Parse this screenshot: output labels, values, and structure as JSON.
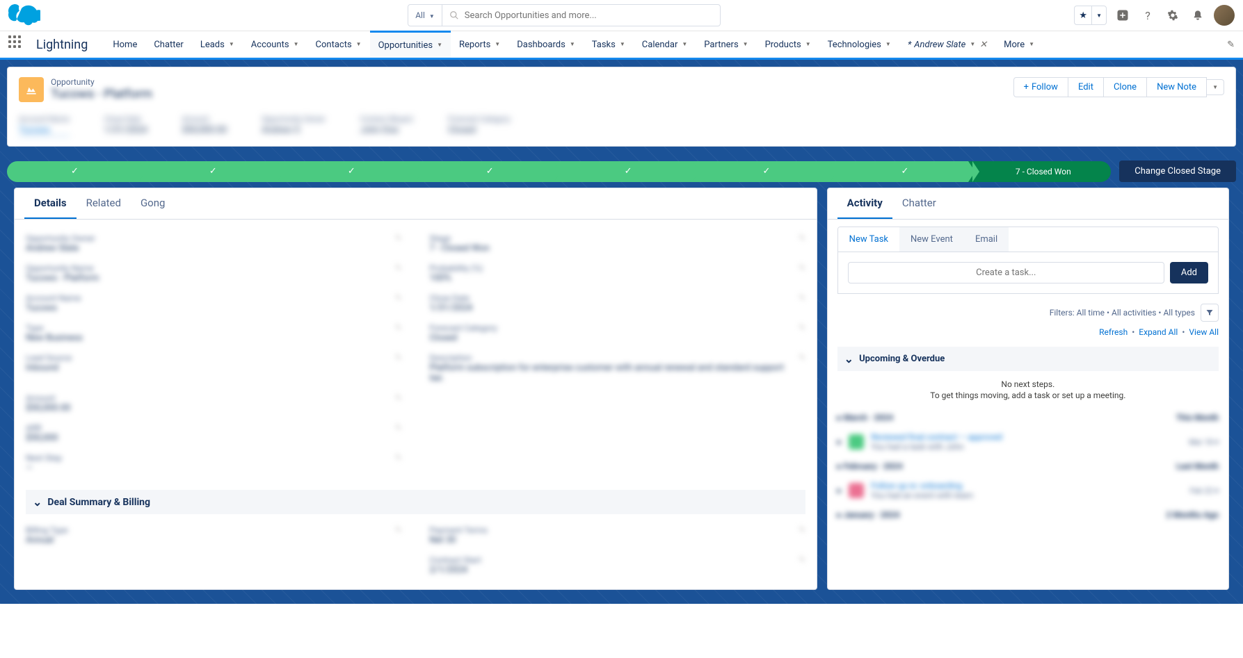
{
  "topbar": {
    "searchScope": "All",
    "searchPlaceholder": "Search Opportunities and more..."
  },
  "nav": {
    "appName": "Lightning",
    "items": [
      "Home",
      "Chatter",
      "Leads",
      "Accounts",
      "Contacts",
      "Opportunities",
      "Reports",
      "Dashboards",
      "Tasks",
      "Calendar",
      "Partners",
      "Products",
      "Technologies"
    ],
    "activeItem": "Opportunities",
    "pinnedTab": "Andrew Slate",
    "more": "More"
  },
  "record": {
    "type": "Opportunity",
    "name": "Tucows - Platform",
    "actions": {
      "follow": "Follow",
      "edit": "Edit",
      "clone": "Clone",
      "newNote": "New Note"
    },
    "highlights": [
      {
        "label": "Account Name",
        "value": "Tucows",
        "link": true
      },
      {
        "label": "Close Date",
        "value": "1/31/2024"
      },
      {
        "label": "Amount",
        "value": "$50,000.00"
      },
      {
        "label": "Opportunity Owner",
        "value": "Andrew S"
      },
      {
        "label": "Contact (Buyer)",
        "value": "John Doe"
      },
      {
        "label": "Forecast Category",
        "value": "Closed"
      }
    ]
  },
  "path": {
    "finalLabel": "7 - Closed Won",
    "changeButton": "Change Closed Stage"
  },
  "leftTabs": [
    "Details",
    "Related",
    "Gong"
  ],
  "details": {
    "sectionHeader": "Deal Summary & Billing",
    "leftFields": [
      {
        "label": "Opportunity Owner",
        "value": "Andrew Slate"
      },
      {
        "label": "Opportunity Name",
        "value": "Tucows - Platform"
      },
      {
        "label": "Account Name",
        "value": "Tucows"
      },
      {
        "label": "Type",
        "value": "New Business"
      },
      {
        "label": "Lead Source",
        "value": "Inbound"
      },
      {
        "label": "Amount",
        "value": "$50,000.00"
      },
      {
        "label": "ARR",
        "value": "$50,000"
      },
      {
        "label": "Next Step",
        "value": "—"
      }
    ],
    "rightFields": [
      {
        "label": "Stage",
        "value": "7 - Closed Won"
      },
      {
        "label": "Probability (%)",
        "value": "100%"
      },
      {
        "label": "Close Date",
        "value": "1/31/2024"
      },
      {
        "label": "Forecast Category",
        "value": "Closed"
      },
      {
        "label": "Description",
        "value": "Platform subscription for enterprise customer with annual renewal and standard support tier."
      }
    ],
    "billingLeft": [
      {
        "label": "Billing Type",
        "value": "Annual"
      }
    ],
    "billingRight": [
      {
        "label": "Payment Terms",
        "value": "Net 30"
      },
      {
        "label": "Contract Start",
        "value": "2/1/2024"
      }
    ]
  },
  "activity": {
    "tabs": [
      "Activity",
      "Chatter"
    ],
    "subtabs": [
      "New Task",
      "New Event",
      "Email"
    ],
    "taskPlaceholder": "Create a task...",
    "addButton": "Add",
    "filtersText": "Filters: All time • All activities • All types",
    "links": {
      "refresh": "Refresh",
      "expand": "Expand All",
      "viewAll": "View All"
    },
    "upcoming": "Upcoming & Overdue",
    "noSteps1": "No next steps.",
    "noSteps2": "To get things moving, add a task or set up a meeting.",
    "timeline": [
      {
        "type": "month",
        "label": "March · 2024",
        "meta": "This Month"
      },
      {
        "type": "item",
        "color": "green",
        "text": "Reviewed final contract — approved",
        "sub": "You had a task with John",
        "date": "Mar 18"
      },
      {
        "type": "month",
        "label": "February · 2024",
        "meta": "Last Month"
      },
      {
        "type": "item",
        "color": "pink",
        "text": "Follow up re: onboarding",
        "sub": "You had an event with team",
        "date": "Feb 22"
      },
      {
        "type": "month",
        "label": "January · 2024",
        "meta": "2 Months Ago"
      }
    ]
  }
}
